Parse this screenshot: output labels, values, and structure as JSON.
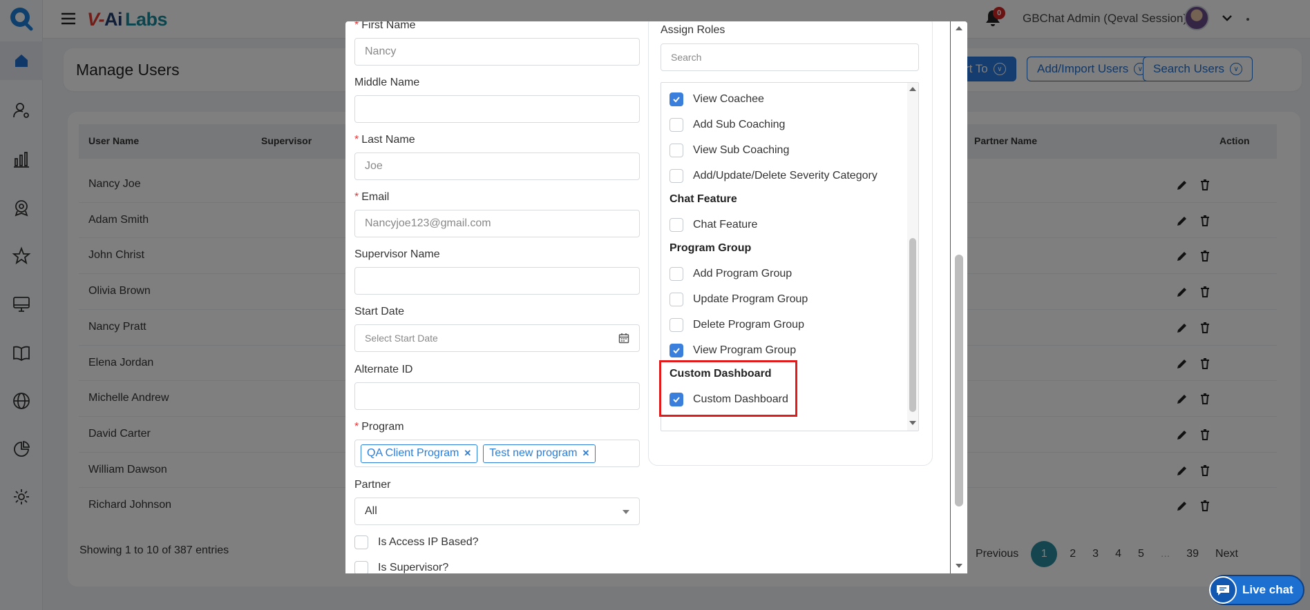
{
  "topbar": {
    "brand_v": "V-",
    "brand_ai": "Ai",
    "brand_labs": "Labs",
    "notification_count": "0",
    "user_name": "GBChat Admin (Qeval Session)"
  },
  "sidebar": {
    "items": [
      {
        "icon": "home-icon"
      },
      {
        "icon": "user-settings-icon"
      },
      {
        "icon": "bar-chart-icon"
      },
      {
        "icon": "badge-icon"
      },
      {
        "icon": "star-icon"
      },
      {
        "icon": "monitor-icon"
      },
      {
        "icon": "book-icon"
      },
      {
        "icon": "globe-icon"
      },
      {
        "icon": "pie-chart-icon"
      },
      {
        "icon": "gear-icon"
      }
    ]
  },
  "page": {
    "title": "Manage Users",
    "buttons": {
      "report_to": "rt To",
      "add_import": "Add/Import Users",
      "search_users": "Search Users"
    },
    "table": {
      "headers": {
        "user_name": "User Name",
        "supervisor": "Supervisor",
        "partner_name": "Partner Name",
        "action": "Action"
      },
      "rows": [
        "Nancy Joe",
        "Adam Smith",
        "John Christ",
        "Olivia Brown",
        "Nancy Pratt",
        "Elena Jordan",
        "Michelle Andrew",
        "David Carter",
        "William Dawson",
        "Richard Johnson"
      ]
    },
    "showing": "Showing 1 to 10 of 387 entries",
    "pagination": {
      "previous": "Previous",
      "pages": [
        "1",
        "2",
        "3",
        "4",
        "5",
        "...",
        "39"
      ],
      "next": "Next"
    }
  },
  "modal": {
    "first_name": {
      "label": "First Name",
      "value": "Nancy"
    },
    "middle_name": {
      "label": "Middle Name",
      "value": ""
    },
    "last_name": {
      "label": "Last Name",
      "value": "Joe"
    },
    "email": {
      "label": "Email",
      "value": "Nancyjoe123@gmail.com"
    },
    "supervisor_name": {
      "label": "Supervisor Name",
      "value": ""
    },
    "start_date": {
      "label": "Start Date",
      "placeholder": "Select Start Date"
    },
    "alternate_id": {
      "label": "Alternate ID",
      "value": ""
    },
    "program": {
      "label": "Program",
      "tags": [
        "QA Client Program",
        "Test new program"
      ]
    },
    "partner": {
      "label": "Partner",
      "value": "All"
    },
    "is_access_ip_based": {
      "label": "Is Access IP Based?",
      "checked": false
    },
    "is_supervisor": {
      "label": "Is Supervisor?",
      "checked": false
    },
    "assign_roles": {
      "title": "Assign Roles",
      "search_placeholder": "Search",
      "items": [
        {
          "label": "View Coachee",
          "checked": true
        },
        {
          "label": "Add Sub Coaching",
          "checked": false
        },
        {
          "label": "View Sub Coaching",
          "checked": false
        },
        {
          "label": "Add/Update/Delete Severity Category",
          "checked": false
        }
      ],
      "groups": [
        {
          "name": "Chat Feature",
          "items": [
            {
              "label": "Chat Feature",
              "checked": false
            }
          ]
        },
        {
          "name": "Program Group",
          "items": [
            {
              "label": "Add Program Group",
              "checked": false
            },
            {
              "label": "Update Program Group",
              "checked": false
            },
            {
              "label": "Delete Program Group",
              "checked": false
            },
            {
              "label": "View Program Group",
              "checked": true
            }
          ]
        },
        {
          "name": "Custom Dashboard",
          "items": [
            {
              "label": "Custom Dashboard",
              "checked": true
            }
          ]
        }
      ]
    }
  },
  "live_chat": "Live chat",
  "colors": {
    "accent": "#2d7be0",
    "checkbox_on": "#3b7fdc",
    "highlight": "#e01b1b",
    "pager_active": "#2a8c9e",
    "required": "#e03a3a"
  }
}
